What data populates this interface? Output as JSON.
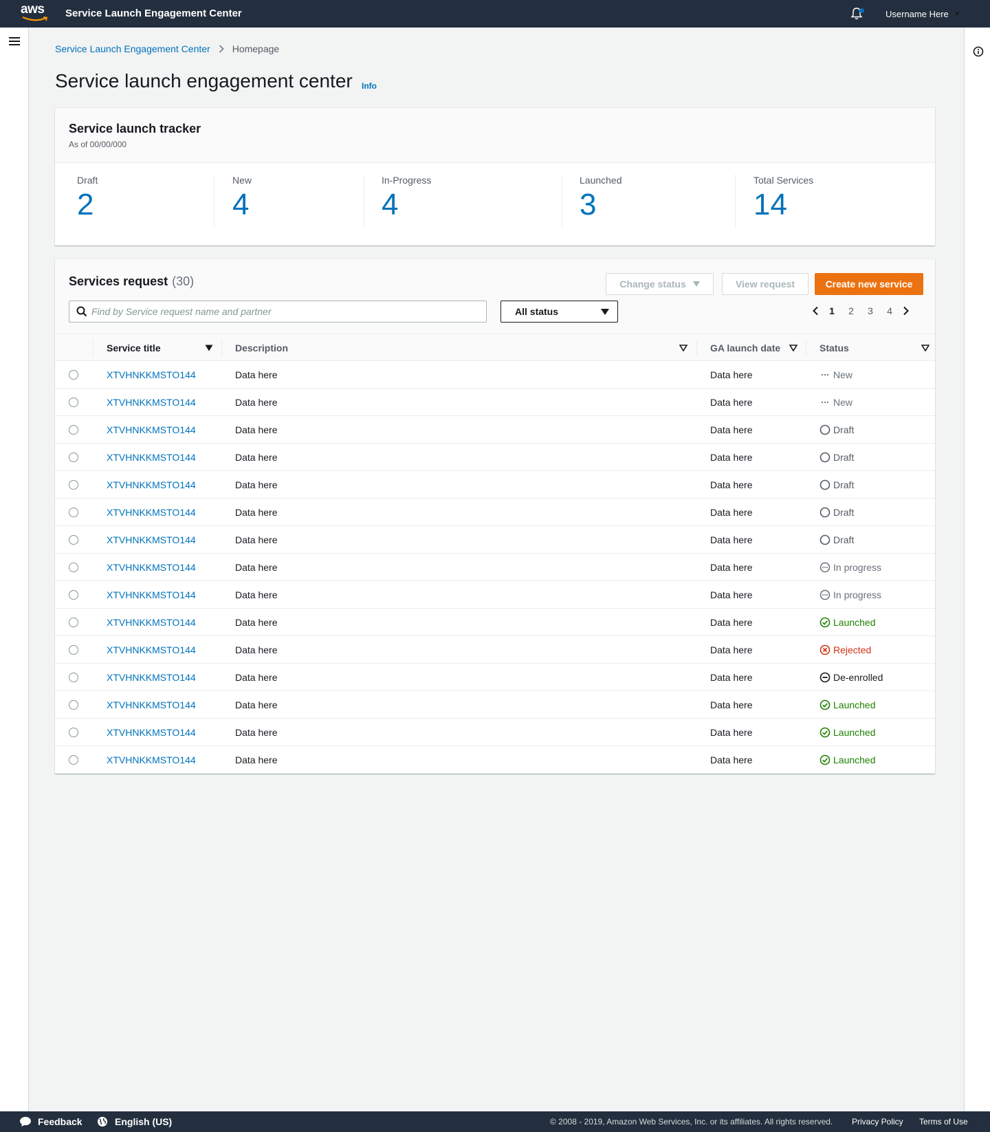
{
  "header": {
    "logo_text": "aws",
    "app_title": "Service Launch Engagement Center",
    "username": "Username Here"
  },
  "breadcrumb": {
    "items": [
      "Service Launch Engagement Center",
      "Homepage"
    ]
  },
  "page": {
    "title": "Service launch engagement center",
    "info_label": "Info"
  },
  "tracker": {
    "title": "Service launch tracker",
    "as_of": "As of 00/00/000",
    "stats": [
      {
        "label": "Draft",
        "value": "2"
      },
      {
        "label": "New",
        "value": "4"
      },
      {
        "label": "In-Progress",
        "value": "4"
      },
      {
        "label": "Launched",
        "value": "3"
      },
      {
        "label": "Total Services",
        "value": "14"
      }
    ]
  },
  "services": {
    "title": "Services request",
    "count": "(30)",
    "buttons": {
      "change_status": "Change status",
      "view_request": "View request",
      "create": "Create new service"
    },
    "search_placeholder": "Find by Service request name and partner",
    "filter_value": "All status",
    "pagination": {
      "pages": [
        "1",
        "2",
        "3",
        "4"
      ],
      "current": "1"
    },
    "columns": [
      "Service title",
      "Description",
      "GA launch date",
      "Status"
    ],
    "rows": [
      {
        "title": "XTVHNKKMSTO144",
        "description": "Data here",
        "date": "Data here",
        "status": "New",
        "kind": "new"
      },
      {
        "title": "XTVHNKKMSTO144",
        "description": "Data here",
        "date": "Data here",
        "status": "New",
        "kind": "new"
      },
      {
        "title": "XTVHNKKMSTO144",
        "description": "Data here",
        "date": "Data here",
        "status": "Draft",
        "kind": "draft"
      },
      {
        "title": "XTVHNKKMSTO144",
        "description": "Data here",
        "date": "Data here",
        "status": "Draft",
        "kind": "draft"
      },
      {
        "title": "XTVHNKKMSTO144",
        "description": "Data here",
        "date": "Data here",
        "status": "Draft",
        "kind": "draft"
      },
      {
        "title": "XTVHNKKMSTO144",
        "description": "Data here",
        "date": "Data here",
        "status": "Draft",
        "kind": "draft"
      },
      {
        "title": "XTVHNKKMSTO144",
        "description": "Data here",
        "date": "Data here",
        "status": "Draft",
        "kind": "draft"
      },
      {
        "title": "XTVHNKKMSTO144",
        "description": "Data here",
        "date": "Data here",
        "status": "In progress",
        "kind": "progress"
      },
      {
        "title": "XTVHNKKMSTO144",
        "description": "Data here",
        "date": "Data here",
        "status": "In progress",
        "kind": "progress"
      },
      {
        "title": "XTVHNKKMSTO144",
        "description": "Data here",
        "date": "Data here",
        "status": "Launched",
        "kind": "launched"
      },
      {
        "title": "XTVHNKKMSTO144",
        "description": "Data here",
        "date": "Data here",
        "status": "Rejected",
        "kind": "rejected"
      },
      {
        "title": "XTVHNKKMSTO144",
        "description": "Data here",
        "date": "Data here",
        "status": "De-enrolled",
        "kind": "deenrolled"
      },
      {
        "title": "XTVHNKKMSTO144",
        "description": "Data here",
        "date": "Data here",
        "status": "Launched",
        "kind": "launched"
      },
      {
        "title": "XTVHNKKMSTO144",
        "description": "Data here",
        "date": "Data here",
        "status": "Launched",
        "kind": "launched"
      },
      {
        "title": "XTVHNKKMSTO144",
        "description": "Data here",
        "date": "Data here",
        "status": "Launched",
        "kind": "launched"
      }
    ]
  },
  "status_colors": {
    "new": "#687078",
    "draft": "#545b64",
    "progress": "#687078",
    "launched": "#1d8102",
    "rejected": "#d13212",
    "deenrolled": "#16191f"
  },
  "colors": {
    "accent": "#0073bb",
    "primary_button": "#ec7211",
    "header_bg": "#232f3e"
  },
  "footer": {
    "feedback": "Feedback",
    "language": "English (US)",
    "copyright": "© 2008 - 2019, Amazon Web Services, Inc. or its affiliates. All rights reserved.",
    "privacy": "Privacy Policy",
    "terms": "Terms of Use"
  }
}
